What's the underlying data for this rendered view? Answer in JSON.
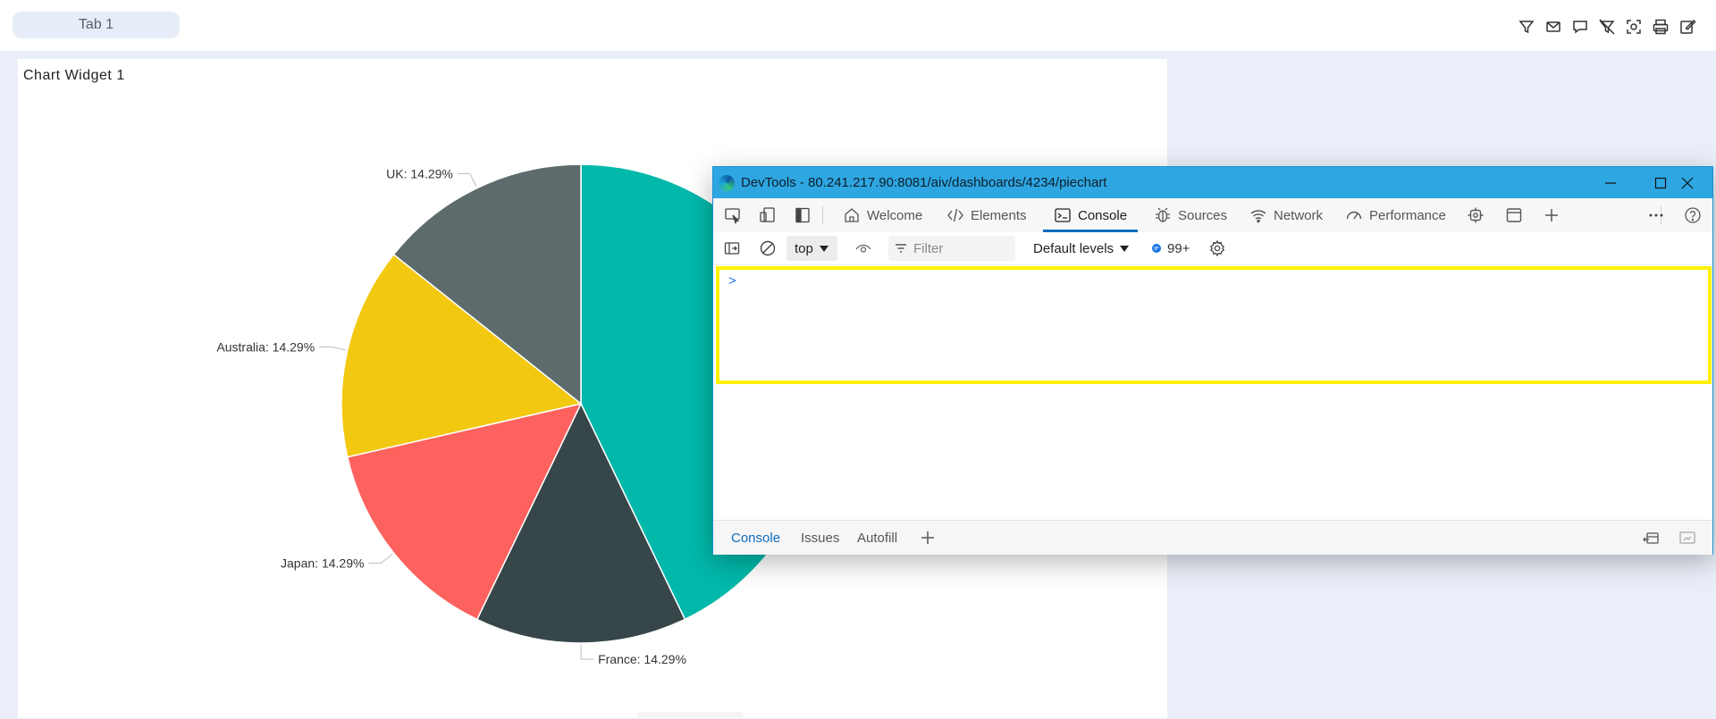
{
  "header": {
    "tab_label": "Tab 1",
    "toolbar_icons": [
      "filter-icon",
      "mail-icon",
      "comment-icon",
      "clear-filter-icon",
      "screenshot-icon",
      "print-icon",
      "edit-icon"
    ]
  },
  "widget": {
    "title": "Chart Widget 1"
  },
  "chart_data": {
    "type": "pie",
    "title": "Chart Widget 1",
    "slices": [
      {
        "label": "UK",
        "value": 14.29,
        "display": "UK: 14.29%",
        "color": "#5e6b6d"
      },
      {
        "label": "Australia",
        "value": 14.29,
        "display": "Australia: 14.29%",
        "color": "#f2c811"
      },
      {
        "label": "Japan",
        "value": 14.29,
        "display": "Japan: 14.29%",
        "color": "#fd625e"
      },
      {
        "label": "France",
        "value": 14.29,
        "display": "France: 14.29%",
        "color": "#374649"
      }
    ],
    "partially_hidden_slice": {
      "value": 42.86,
      "color": "#01b8aa"
    }
  },
  "devtools": {
    "title": "DevTools - 80.241.217.90:8081/aiv/dashboards/4234/piechart",
    "tabs": [
      {
        "label": "Welcome",
        "icon": "home-icon"
      },
      {
        "label": "Elements",
        "icon": "code-icon"
      },
      {
        "label": "Console",
        "icon": "console-icon",
        "active": true
      },
      {
        "label": "Sources",
        "icon": "bug-icon"
      },
      {
        "label": "Network",
        "icon": "wifi-icon"
      },
      {
        "label": "Performance",
        "icon": "gauge-icon"
      }
    ],
    "toolbar": {
      "context": "top",
      "filter_placeholder": "Filter",
      "levels": "Default levels",
      "message_count": "99+"
    },
    "console_prompt": ">",
    "drawer_tabs": [
      "Console",
      "Issues",
      "Autofill"
    ]
  }
}
